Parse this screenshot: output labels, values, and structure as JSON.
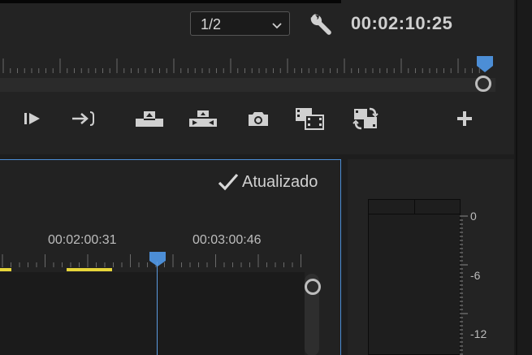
{
  "program_monitor": {
    "resolution": {
      "value": "1/2"
    },
    "timecode": "00:02:10:25",
    "transport": [
      {
        "name": "step-forward-button",
        "icon": "step-forward-icon"
      },
      {
        "name": "go-to-out-button",
        "icon": "go-to-out-icon"
      },
      {
        "name": "lift-button",
        "icon": "lift-icon"
      },
      {
        "name": "extract-button",
        "icon": "extract-icon"
      },
      {
        "name": "export-frame-button",
        "icon": "camera-icon"
      },
      {
        "name": "comparison-view-button",
        "icon": "comparison-view-icon"
      },
      {
        "name": "toggle-proxies-button",
        "icon": "proxy-toggle-icon"
      },
      {
        "name": "button-editor-button",
        "icon": "plus-icon"
      }
    ]
  },
  "timeline": {
    "render_status": "Atualizado",
    "ruler_timecodes": [
      "00:02:00:31",
      "00:03:00:46"
    ],
    "colors": {
      "accent": "#4c8ed6",
      "render_bar": "#e6d53a",
      "playhead": "#4c8ed6"
    }
  },
  "audio_meter": {
    "scale": [
      "0",
      "-6",
      "-12"
    ]
  }
}
